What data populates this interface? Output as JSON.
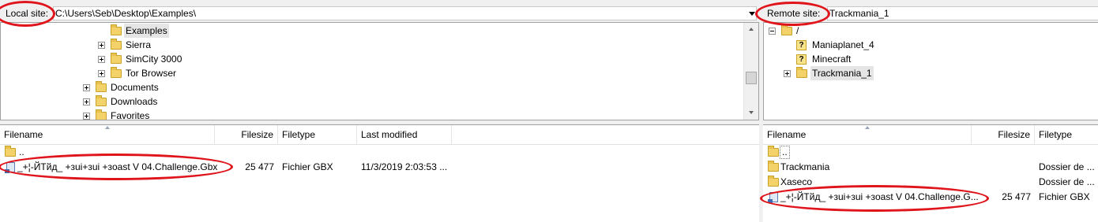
{
  "local": {
    "site_label": "Local site:",
    "path": "C:\\Users\\Seb\\Desktop\\Examples\\",
    "tree": [
      {
        "label": "Examples",
        "selected": true
      },
      {
        "label": "Sierra"
      },
      {
        "label": "SimCity 3000"
      },
      {
        "label": "Tor Browser"
      },
      {
        "label": "Documents"
      },
      {
        "label": "Downloads"
      },
      {
        "label": "Favorites"
      }
    ],
    "columns": [
      "Filename",
      "Filesize",
      "Filetype",
      "Last modified"
    ],
    "files": [
      {
        "name": "..",
        "size": "",
        "type": "",
        "modified": ""
      },
      {
        "name": "_+¦-ЙТйд_ +зui+зui +зoast V 04.Challenge.Gbx",
        "size": "25 477",
        "type": "Fichier GBX",
        "modified": "11/3/2019 2:03:53 ..."
      }
    ]
  },
  "remote": {
    "site_label": "Remote site:",
    "path": "Trackmania_1",
    "tree": [
      {
        "label": "/"
      },
      {
        "label": "Maniaplanet_4"
      },
      {
        "label": "Minecraft"
      },
      {
        "label": "Trackmania_1"
      }
    ],
    "columns": [
      "Filename",
      "Filesize",
      "Filetype"
    ],
    "files": [
      {
        "name": "..",
        "size": "",
        "type": ""
      },
      {
        "name": "Trackmania",
        "size": "",
        "type": "Dossier de ..."
      },
      {
        "name": "Xaseco",
        "size": "",
        "type": "Dossier de ..."
      },
      {
        "name": "_+¦-ЙТйд_ +зui+зui +зoast V 04.Challenge.G...",
        "size": "25 477",
        "type": "Fichier GBX"
      }
    ]
  },
  "colors": {
    "annotation": "#e0141b",
    "folder": "#f4d26a",
    "selection": "#e5e5e5"
  }
}
